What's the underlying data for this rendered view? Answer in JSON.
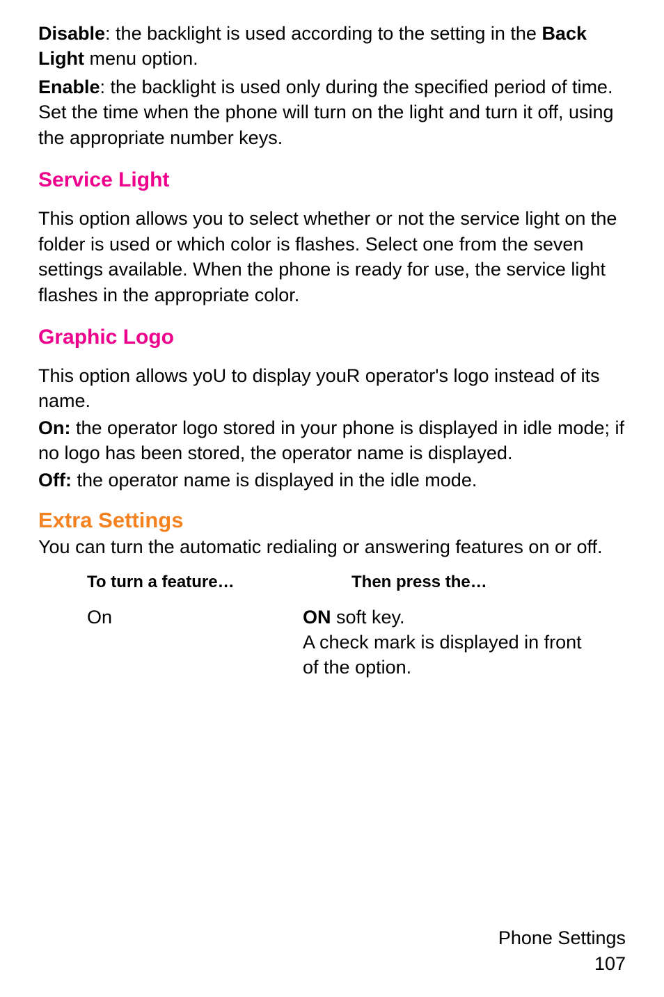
{
  "para1": {
    "disable_label": "Disable",
    "disable_rest": ": the backlight is used according to the setting in the ",
    "backlight_label": "Back Light",
    "backlight_rest": " menu option.",
    "enable_label": "Enable",
    "enable_rest": ": the backlight is used only during the specified period of time. Set the time when the phone will turn on the light and turn it off, using the appropriate number keys."
  },
  "service_light": {
    "heading": "Service Light",
    "body": "This option allows you to select whether or not the service light on the folder is used or which color is flashes. Select one from the seven settings available. When the phone is ready for use, the service light flashes in the appropriate color."
  },
  "graphic_logo": {
    "heading": "Graphic Logo",
    "intro": "This option allows yoU to display youR operator's logo instead of its name.",
    "on_label": "On:",
    "on_rest": " the operator logo stored in your phone is displayed in idle mode; if no logo has been stored, the operator name is displayed.",
    "off_label": "Off:",
    "off_rest": " the operator name is displayed in the idle mode."
  },
  "extra_settings": {
    "heading": "Extra Settings",
    "intro": "You can turn the automatic redialing or answering features on or off.",
    "table": {
      "header1": "To turn a feature…",
      "header2": "Then press the…",
      "row1": {
        "col1": "On",
        "on_label": "ON",
        "col2_rest": " soft key.",
        "col2_line2": "A check mark is displayed in front of the option."
      }
    }
  },
  "footer": {
    "section": "Phone Settings",
    "page": "107"
  }
}
